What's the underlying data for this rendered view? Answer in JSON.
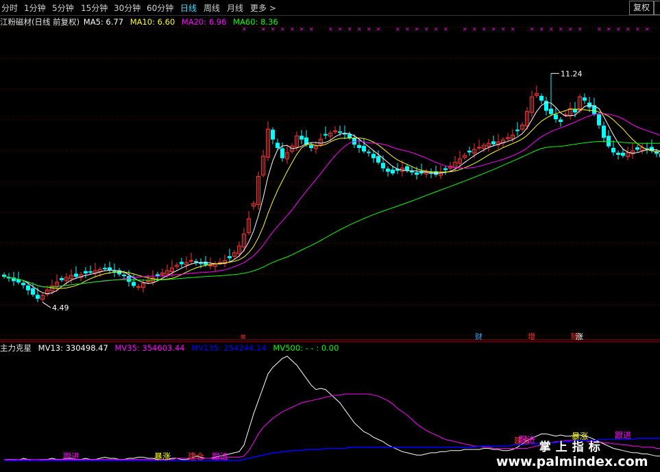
{
  "toolbar": {
    "periods": [
      "分时",
      "1分钟",
      "5分钟",
      "15分钟",
      "30分钟",
      "60分钟",
      "日线",
      "周线",
      "月线",
      "更多 >"
    ],
    "active_period": "日线",
    "fq_button": "复权"
  },
  "colors": {
    "up": "#ff3232",
    "down": "#00ffff",
    "ma5": "#ffffff",
    "ma10": "#ffff00",
    "ma20": "#ff00ff",
    "ma60": "#00ff00",
    "mv500": "#0000ff"
  },
  "main_legend": {
    "title": "江粉磁材(日线 前复权)",
    "items": [
      {
        "text": "MA5: 6.77",
        "color": "#ffffff"
      },
      {
        "text": "MA10: 6.60",
        "color": "#ffff00"
      },
      {
        "text": "MA20: 6.96",
        "color": "#ff00ff"
      },
      {
        "text": "MA60: 8.36",
        "color": "#00ff00"
      }
    ]
  },
  "sub_legend": {
    "title": "主力克星",
    "items": [
      {
        "text": "MV13: 330498.47",
        "color": "#ffffff"
      },
      {
        "text": "MV35: 354603.44",
        "color": "#ff00ff"
      },
      {
        "text": "MV135: 254244.14",
        "color": "#0000ff"
      },
      {
        "text": "MV500: - - : 0.00",
        "color": "#00ff00"
      }
    ]
  },
  "watermark": {
    "cn": "掌上指标",
    "url": "www.palmindex.com"
  },
  "chart_data": [
    {
      "type": "candlestick",
      "title": "江粉磁材(日线 前复权)",
      "ylim": [
        3.5,
        12.6
      ],
      "grid": true,
      "annotations": [
        {
          "text": "4.49",
          "value": 4.49,
          "kind": "low"
        },
        {
          "text": "11.24",
          "value": 11.24,
          "kind": "high"
        }
      ],
      "event_markers": [
        {
          "index": 50,
          "text": "≋",
          "color": "#ff3232"
        },
        {
          "index": 99,
          "text": "财",
          "color": "#33aaff"
        },
        {
          "index": 110,
          "text": "增",
          "color": "#ff3232"
        },
        {
          "index": 119,
          "text": "除",
          "color": "#ff3232"
        },
        {
          "index": 120,
          "text": "涨",
          "color": "#ffffff"
        }
      ],
      "ma_series": [
        "MA5",
        "MA10",
        "MA20",
        "MA60"
      ],
      "closes": [
        5.25,
        5.2,
        5.12,
        5.08,
        5.0,
        4.85,
        4.72,
        4.6,
        4.68,
        4.85,
        4.97,
        5.08,
        5.15,
        5.22,
        5.28,
        5.25,
        5.3,
        5.35,
        5.38,
        5.42,
        5.45,
        5.48,
        5.43,
        5.38,
        5.32,
        5.28,
        5.1,
        4.98,
        4.95,
        5.05,
        5.12,
        5.2,
        5.26,
        5.35,
        5.42,
        5.5,
        5.58,
        5.62,
        5.66,
        5.72,
        5.68,
        5.64,
        5.6,
        5.58,
        5.62,
        5.66,
        5.72,
        5.8,
        5.95,
        6.15,
        6.5,
        6.95,
        7.4,
        8.2,
        8.8,
        9.6,
        9.3,
        9.05,
        8.75,
        8.9,
        9.1,
        9.4,
        9.3,
        9.15,
        9.05,
        9.1,
        9.3,
        9.42,
        9.48,
        9.55,
        9.5,
        9.45,
        9.35,
        9.15,
        9.05,
        8.95,
        8.9,
        8.75,
        8.62,
        8.45,
        8.35,
        8.3,
        8.38,
        8.45,
        8.38,
        8.34,
        8.26,
        8.3,
        8.34,
        8.3,
        8.26,
        8.3,
        8.4,
        8.5,
        8.62,
        8.72,
        8.82,
        8.92,
        9.0,
        9.06,
        9.12,
        9.18,
        9.16,
        9.22,
        9.28,
        9.35,
        9.42,
        9.55,
        9.72,
        10.12,
        10.55,
        10.65,
        10.45,
        10.15,
        10.05,
        9.9,
        9.82,
        10.02,
        10.2,
        10.1,
        10.55,
        10.45,
        10.25,
        10.05,
        9.72,
        9.35,
        9.1,
        8.92,
        8.85,
        8.82,
        8.9,
        8.96,
        9.0,
        9.05,
        9.02,
        8.96,
        8.88,
        8.78,
        8.62
      ]
    },
    {
      "type": "line",
      "title": "主力克星",
      "series": [
        {
          "name": "MV13",
          "color": "#ffffff"
        },
        {
          "name": "MV35",
          "color": "#ff00ff"
        },
        {
          "name": "MV135",
          "color": "#0000ff"
        }
      ],
      "mv13": [
        0.06,
        0.07,
        0.07,
        0.06,
        0.08,
        0.07,
        0.06,
        0.06,
        0.07,
        0.07,
        0.08,
        0.07,
        0.07,
        0.08,
        0.08,
        0.07,
        0.07,
        0.08,
        0.07,
        0.07,
        0.08,
        0.09,
        0.08,
        0.08,
        0.07,
        0.07,
        0.08,
        0.08,
        0.09,
        0.09,
        0.08,
        0.08,
        0.07,
        0.07,
        0.07,
        0.08,
        0.08,
        0.07,
        0.07,
        0.08,
        0.1,
        0.09,
        0.08,
        0.08,
        0.09,
        0.1,
        0.11,
        0.12,
        0.13,
        0.14,
        0.2,
        0.34,
        0.48,
        0.6,
        0.72,
        0.84,
        0.9,
        0.94,
        0.98,
        1.0,
        0.96,
        0.92,
        0.86,
        0.8,
        0.74,
        0.7,
        0.71,
        0.7,
        0.66,
        0.62,
        0.58,
        0.52,
        0.46,
        0.4,
        0.36,
        0.32,
        0.3,
        0.27,
        0.25,
        0.23,
        0.2,
        0.18,
        0.16,
        0.14,
        0.13,
        0.12,
        0.11,
        0.11,
        0.12,
        0.13,
        0.13,
        0.14,
        0.14,
        0.15,
        0.15,
        0.15,
        0.16,
        0.16,
        0.16,
        0.16,
        0.17,
        0.17,
        0.16,
        0.16,
        0.15,
        0.15,
        0.16,
        0.18,
        0.21,
        0.24,
        0.26,
        0.28,
        0.3,
        0.3,
        0.29,
        0.28,
        0.29,
        0.28,
        0.28,
        0.29,
        0.29,
        0.28,
        0.27,
        0.25,
        0.23,
        0.21,
        0.19,
        0.17,
        0.16,
        0.15,
        0.14,
        0.13,
        0.13,
        0.12,
        0.12,
        0.11,
        0.1,
        0.1,
        0.09
      ],
      "mv35": [
        0.07,
        0.07,
        0.07,
        0.07,
        0.07,
        0.07,
        0.07,
        0.07,
        0.07,
        0.07,
        0.07,
        0.07,
        0.07,
        0.07,
        0.07,
        0.07,
        0.07,
        0.07,
        0.07,
        0.07,
        0.07,
        0.07,
        0.07,
        0.07,
        0.07,
        0.07,
        0.07,
        0.07,
        0.07,
        0.07,
        0.07,
        0.07,
        0.07,
        0.07,
        0.07,
        0.07,
        0.08,
        0.08,
        0.08,
        0.08,
        0.08,
        0.08,
        0.08,
        0.08,
        0.08,
        0.08,
        0.08,
        0.09,
        0.09,
        0.09,
        0.1,
        0.15,
        0.22,
        0.3,
        0.36,
        0.4,
        0.44,
        0.47,
        0.5,
        0.52,
        0.54,
        0.56,
        0.58,
        0.59,
        0.6,
        0.61,
        0.62,
        0.63,
        0.64,
        0.65,
        0.65,
        0.66,
        0.66,
        0.66,
        0.66,
        0.66,
        0.66,
        0.65,
        0.64,
        0.62,
        0.6,
        0.57,
        0.53,
        0.5,
        0.47,
        0.43,
        0.39,
        0.36,
        0.33,
        0.31,
        0.29,
        0.27,
        0.25,
        0.24,
        0.23,
        0.22,
        0.21,
        0.2,
        0.19,
        0.19,
        0.18,
        0.18,
        0.17,
        0.17,
        0.17,
        0.17,
        0.17,
        0.17,
        0.17,
        0.17,
        0.18,
        0.19,
        0.2,
        0.21,
        0.22,
        0.23,
        0.23,
        0.24,
        0.24,
        0.24,
        0.24,
        0.24,
        0.23,
        0.23,
        0.23,
        0.22,
        0.22,
        0.21,
        0.21,
        0.2,
        0.2,
        0.19,
        0.19,
        0.18,
        0.18,
        0.18,
        0.17,
        0.17,
        0.17
      ],
      "mv135": [
        0.06,
        0.06,
        0.06,
        0.06,
        0.06,
        0.06,
        0.06,
        0.06,
        0.06,
        0.06,
        0.06,
        0.06,
        0.06,
        0.06,
        0.06,
        0.06,
        0.06,
        0.06,
        0.06,
        0.06,
        0.06,
        0.06,
        0.06,
        0.06,
        0.06,
        0.06,
        0.06,
        0.06,
        0.06,
        0.06,
        0.06,
        0.06,
        0.06,
        0.06,
        0.06,
        0.06,
        0.06,
        0.06,
        0.06,
        0.06,
        0.06,
        0.06,
        0.06,
        0.06,
        0.06,
        0.06,
        0.06,
        0.06,
        0.06,
        0.06,
        0.07,
        0.08,
        0.09,
        0.1,
        0.11,
        0.12,
        0.13,
        0.13,
        0.14,
        0.14,
        0.15,
        0.15,
        0.15,
        0.16,
        0.16,
        0.16,
        0.16,
        0.17,
        0.17,
        0.17,
        0.17,
        0.17,
        0.18,
        0.18,
        0.18,
        0.18,
        0.18,
        0.18,
        0.18,
        0.18,
        0.18,
        0.18,
        0.18,
        0.18,
        0.18,
        0.18,
        0.18,
        0.18,
        0.18,
        0.18,
        0.18,
        0.18,
        0.18,
        0.18,
        0.18,
        0.18,
        0.18,
        0.18,
        0.18,
        0.19,
        0.19,
        0.19,
        0.19,
        0.19,
        0.19,
        0.19,
        0.2,
        0.2,
        0.2,
        0.21,
        0.21,
        0.21,
        0.22,
        0.22,
        0.22,
        0.22,
        0.23,
        0.23,
        0.23,
        0.24,
        0.24,
        0.24,
        0.24,
        0.24,
        0.25,
        0.25,
        0.25,
        0.25,
        0.25,
        0.25,
        0.25,
        0.25,
        0.26,
        0.26,
        0.26,
        0.26,
        0.26,
        0.26,
        0.26
      ],
      "signals": [
        {
          "index": 14,
          "text": "跟进",
          "color": "#ff00ff"
        },
        {
          "index": 33,
          "text": "暴涨",
          "color": "#ffff00"
        },
        {
          "index": 40,
          "text": "建仓",
          "color": "#ff3232"
        },
        {
          "index": 45,
          "text": "跟进",
          "color": "#ff00ff"
        },
        {
          "index": 108,
          "text": "建仓",
          "color": "#ff3232"
        },
        {
          "index": 109,
          "text": "跟进",
          "color": "#ff00ff"
        },
        {
          "index": 120,
          "text": "暴涨",
          "color": "#ffff00"
        },
        {
          "index": 129,
          "text": "跟进",
          "color": "#ff00ff"
        }
      ]
    }
  ]
}
